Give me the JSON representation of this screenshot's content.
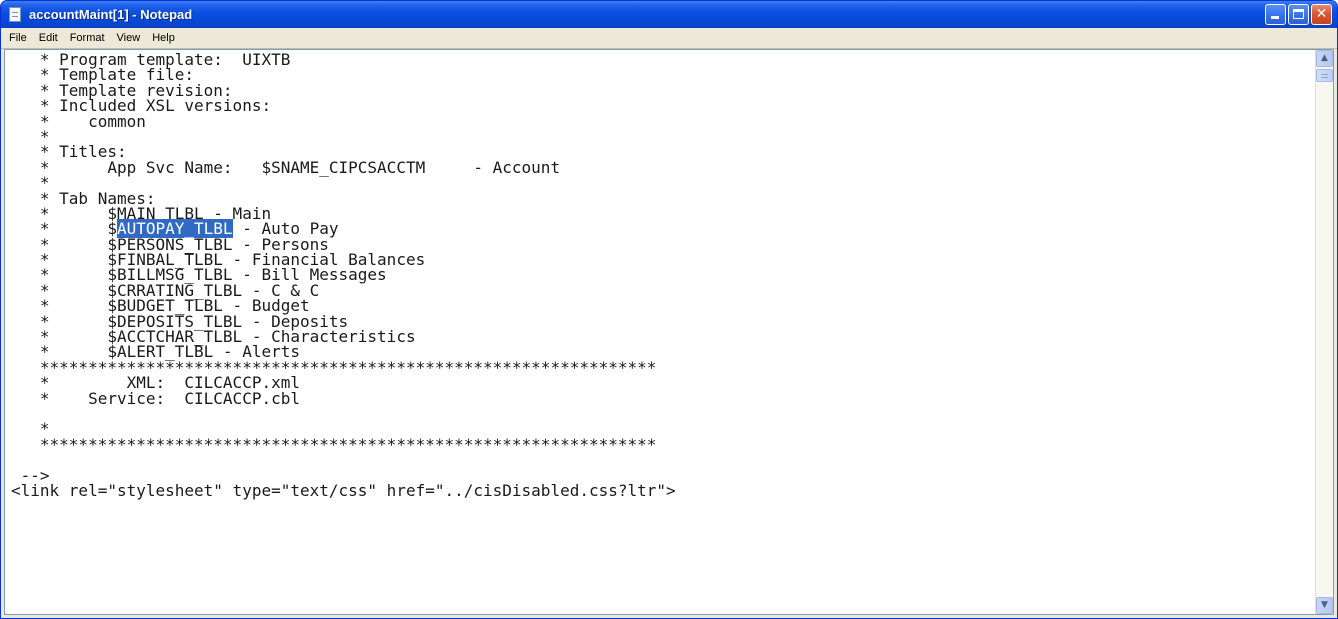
{
  "window": {
    "title": "accountMaint[1] - Notepad",
    "title_color": "#0a4ee0",
    "close_color": "#d8552e",
    "buttons": {
      "minimize_glyph": "",
      "maximize_glyph": "",
      "close_glyph": "✕"
    }
  },
  "menu": [
    {
      "label": "File"
    },
    {
      "label": "Edit"
    },
    {
      "label": "Format"
    },
    {
      "label": "View"
    },
    {
      "label": "Help"
    }
  ],
  "editor": {
    "selection_color": "#316ac5",
    "lines": [
      {
        "text": "   * Program template:  UIXTB"
      },
      {
        "text": "   * Template file:"
      },
      {
        "text": "   * Template revision:"
      },
      {
        "text": "   * Included XSL versions:"
      },
      {
        "text": "   *    common"
      },
      {
        "text": "   *"
      },
      {
        "text": "   * Titles:"
      },
      {
        "text": "   *      App Svc Name:   $SNAME_CIPCSACCTM     - Account"
      },
      {
        "text": "   *"
      },
      {
        "text": "   * Tab Names:"
      },
      {
        "text": "   *      $MAIN_TLBL - Main"
      },
      {
        "text": "   *      $",
        "hl": "AUTOPAY_TLBL",
        "after": " - Auto Pay"
      },
      {
        "text": "   *      $PERSONS_TLBL - Persons"
      },
      {
        "text": "   *      $FINBAL_TLBL - Financial Balances"
      },
      {
        "text": "   *      $BILLMSG_TLBL - Bill Messages"
      },
      {
        "text": "   *      $CRRATING_TLBL - C & C"
      },
      {
        "text": "   *      $BUDGET_TLBL - Budget"
      },
      {
        "text": "   *      $DEPOSITS_TLBL - Deposits"
      },
      {
        "text": "   *      $ACCTCHAR_TLBL - Characteristics"
      },
      {
        "text": "   *      $ALERT_TLBL - Alerts"
      },
      {
        "text": "   ****************************************************************"
      },
      {
        "text": "   *        XML:  CILCACCP.xml"
      },
      {
        "text": "   *    Service:  CILCACCP.cbl"
      },
      {
        "text": ""
      },
      {
        "text": "   *"
      },
      {
        "text": "   ****************************************************************"
      },
      {
        "text": ""
      },
      {
        "text": " -->"
      },
      {
        "text": "<link rel=\"stylesheet\" type=\"text/css\" href=\"../cisDisabled.css?ltr\">"
      }
    ]
  },
  "scrollbar": {
    "up_icon": "▲",
    "down_icon": "▼"
  }
}
